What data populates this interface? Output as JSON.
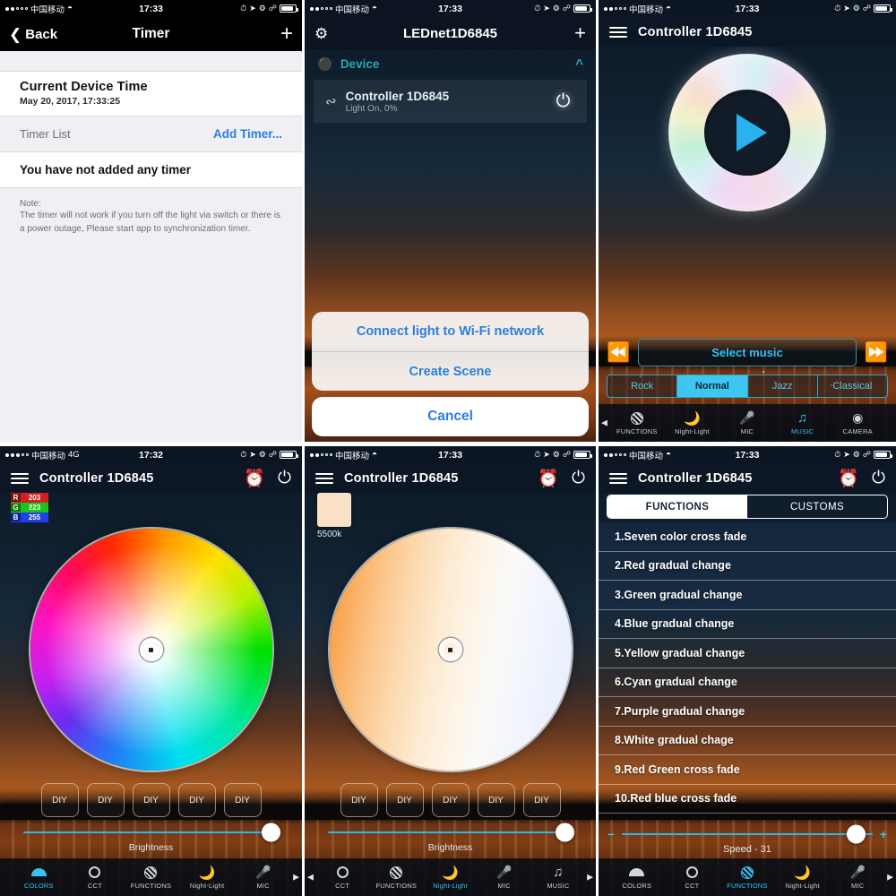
{
  "status_bars": {
    "carrier": "中国移动",
    "time_1733": "17:33",
    "time_1732": "17:32",
    "network_4g": "4G"
  },
  "panel_timer": {
    "nav": {
      "back": "Back",
      "title": "Timer",
      "add_icon": "+"
    },
    "device_time_title": "Current Device Time",
    "device_time_value": "May 20, 2017, 17:33:25",
    "timer_list_label": "Timer List",
    "add_timer_link": "Add Timer...",
    "empty_text": "You have not added any timer",
    "note_label": "Note:",
    "note_text": "The timer will not work if you turn off the light via switch or there is a power outage, Please start app to synchronization timer."
  },
  "panel_devices": {
    "nav": {
      "gear_icon": "gear-icon",
      "title": "LEDnet1D6845",
      "add_icon": "+"
    },
    "section_label": "Device",
    "device": {
      "name": "Controller 1D6845",
      "status": "Light On, 0%",
      "power_icon": "power-icon"
    },
    "action_sheet": {
      "connect": "Connect light to Wi-Fi network",
      "create_scene": "Create Scene",
      "cancel": "Cancel"
    }
  },
  "panel_music": {
    "header_title": "Controller 1D6845",
    "select_music": "Select music",
    "prev_icon": "rewind-icon",
    "next_icon": "fast-forward-icon",
    "play_icon": "play-icon",
    "modes": [
      {
        "label": "Rock",
        "active": false
      },
      {
        "label": "Normal",
        "active": true
      },
      {
        "label": "Jazz",
        "active": false
      },
      {
        "label": "Classical",
        "active": false
      }
    ],
    "tabs": [
      {
        "label": "FUNCTIONS",
        "icon": "functions-icon",
        "active": false
      },
      {
        "label": "Night-Light",
        "icon": "moon-icon",
        "active": false
      },
      {
        "label": "MIC",
        "icon": "mic-icon",
        "active": false
      },
      {
        "label": "MUSIC",
        "icon": "music-note-icon",
        "active": true
      },
      {
        "label": "CAMERA",
        "icon": "camera-icon",
        "active": false
      }
    ]
  },
  "panel_colors": {
    "header_title": "Controller 1D6845",
    "rgb": {
      "r_key": "R",
      "r_value": "203",
      "g_key": "G",
      "g_value": "223",
      "b_key": "B",
      "b_value": "255"
    },
    "diy_buttons": [
      "DIY",
      "DIY",
      "DIY",
      "DIY",
      "DIY"
    ],
    "brightness_label": "Brightness",
    "tabs": [
      {
        "label": "COLORS",
        "icon": "colors-icon",
        "active": true
      },
      {
        "label": "CCT",
        "icon": "cct-icon",
        "active": false
      },
      {
        "label": "FUNCTIONS",
        "icon": "functions-icon",
        "active": false
      },
      {
        "label": "Night-Light",
        "icon": "moon-icon",
        "active": false
      },
      {
        "label": "MIC",
        "icon": "mic-icon",
        "active": false
      }
    ]
  },
  "panel_cct": {
    "header_title": "Controller 1D6845",
    "kelvin_label": "5500k",
    "swatch_color": "#fae0c6",
    "diy_buttons": [
      "DIY",
      "DIY",
      "DIY",
      "DIY",
      "DIY"
    ],
    "brightness_label": "Brightness",
    "tabs": [
      {
        "label": "CCT",
        "icon": "cct-icon",
        "active": false
      },
      {
        "label": "FUNCTIONS",
        "icon": "functions-icon",
        "active": false
      },
      {
        "label": "Night-Light",
        "icon": "moon-icon",
        "active": true
      },
      {
        "label": "MIC",
        "icon": "mic-icon",
        "active": false
      },
      {
        "label": "MUSIC",
        "icon": "music-note-icon",
        "active": false
      }
    ]
  },
  "panel_functions": {
    "header_title": "Controller 1D6845",
    "segments": [
      {
        "label": "FUNCTIONS",
        "active": true
      },
      {
        "label": "CUSTOMS",
        "active": false
      }
    ],
    "items": [
      "1.Seven color cross fade",
      "2.Red gradual change",
      "3.Green gradual change",
      "4.Blue gradual change",
      "5.Yellow gradual change",
      "6.Cyan gradual change",
      "7.Purple gradual change",
      "8.White gradual chage",
      "9.Red Green cross fade",
      "10.Red blue cross fade"
    ],
    "speed_label": "Speed - 31",
    "minus": "−",
    "plus": "+",
    "tabs": [
      {
        "label": "COLORS",
        "icon": "colors-icon",
        "active": false
      },
      {
        "label": "CCT",
        "icon": "cct-icon",
        "active": false
      },
      {
        "label": "FUNCTIONS",
        "icon": "functions-icon",
        "active": true
      },
      {
        "label": "Night-Light",
        "icon": "moon-icon",
        "active": false
      },
      {
        "label": "MIC",
        "icon": "mic-icon",
        "active": false
      }
    ]
  },
  "colors": {
    "accent_cyan": "#36c3f2",
    "ios_blue": "#2b7fe0",
    "teal": "#2aa7b5"
  }
}
